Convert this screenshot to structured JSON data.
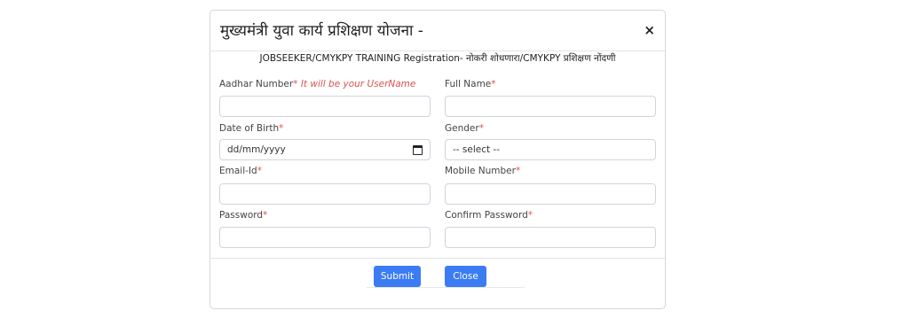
{
  "modal": {
    "title": "मुख्यमंत्री युवा कार्य प्रशिक्षण योजना -",
    "close_symbol": "×",
    "subtitle": "JOBSEEKER/CMYKPY TRAINING Registration- नोकरी शोधणारा/CMYKPY प्रशिक्षण नोंदणी"
  },
  "form": {
    "required_mark": "*",
    "aadhar": {
      "label": "Aadhar Number",
      "hint": "It will be your UserName",
      "value": ""
    },
    "full_name": {
      "label": "Full Name",
      "value": ""
    },
    "dob": {
      "label": "Date of Birth",
      "placeholder": "dd/mm/yyyy"
    },
    "gender": {
      "label": "Gender",
      "selected": "-- select --"
    },
    "email": {
      "label": "Email-Id",
      "value": ""
    },
    "mobile": {
      "label": "Mobile Number",
      "value": ""
    },
    "password": {
      "label": "Password",
      "value": ""
    },
    "confirm_password": {
      "label": "Confirm Password",
      "value": ""
    }
  },
  "footer": {
    "submit_label": "Submit",
    "close_label": "Close"
  },
  "colors": {
    "button": "#3b7cf5",
    "required": "#d9534f"
  },
  "icons": [
    "close-icon",
    "calendar-icon"
  ]
}
